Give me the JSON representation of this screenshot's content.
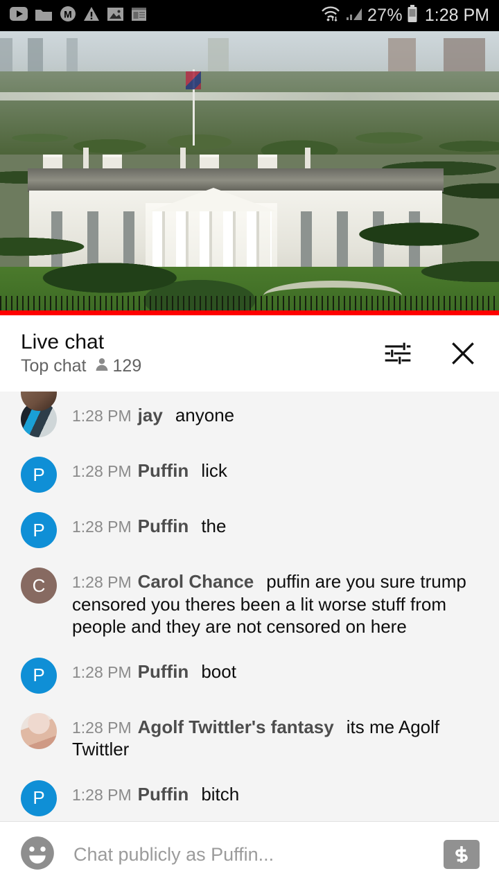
{
  "status_bar": {
    "left_icons": [
      {
        "name": "youtube-icon",
        "label": "YouTube"
      },
      {
        "name": "folder-icon",
        "label": "Folder"
      },
      {
        "name": "m-app-icon",
        "label": "M app"
      },
      {
        "name": "warning-icon",
        "label": "Warning"
      },
      {
        "name": "image-icon",
        "label": "Screenshot"
      },
      {
        "name": "notepad-icon",
        "label": "Notepad"
      }
    ],
    "wifi_icon": "wifi-icon",
    "signal_icon": "cellular-signal-icon",
    "battery_percent": "27%",
    "battery_icon": "battery-icon",
    "clock": "1:28 PM"
  },
  "video": {
    "name": "white-house-live-stream",
    "progress_percent": 100,
    "progress_color": "#ff0000"
  },
  "chat_header": {
    "title": "Live chat",
    "mode": "Top chat",
    "viewer_icon": "person-icon",
    "viewer_count": "129",
    "settings_icon": "tune-icon",
    "close_icon": "close-icon"
  },
  "messages": [
    {
      "avatar_type": "photo",
      "avatar_class": "photo-jay",
      "avatar_initial": "",
      "timestamp": "1:28 PM",
      "author": "jay",
      "text": "anyone"
    },
    {
      "avatar_type": "initial",
      "avatar_class": "initial-p",
      "avatar_initial": "P",
      "timestamp": "1:28 PM",
      "author": "Puffin",
      "text": "lick"
    },
    {
      "avatar_type": "initial",
      "avatar_class": "initial-p",
      "avatar_initial": "P",
      "timestamp": "1:28 PM",
      "author": "Puffin",
      "text": "the"
    },
    {
      "avatar_type": "initial",
      "avatar_class": "initial-c",
      "avatar_initial": "C",
      "timestamp": "1:28 PM",
      "author": "Carol Chance",
      "text": "puffin are you sure trump censored you theres been a lit worse stuff from people and they are not censored on here"
    },
    {
      "avatar_type": "initial",
      "avatar_class": "initial-p",
      "avatar_initial": "P",
      "timestamp": "1:28 PM",
      "author": "Puffin",
      "text": "boot"
    },
    {
      "avatar_type": "photo",
      "avatar_class": "photo-agolf",
      "avatar_initial": "",
      "timestamp": "1:28 PM",
      "author": "Agolf Twittler's fantasy",
      "text": "its me Agolf Twittler"
    },
    {
      "avatar_type": "initial",
      "avatar_class": "initial-p",
      "avatar_initial": "P",
      "timestamp": "1:28 PM",
      "author": "Puffin",
      "text": "bitch"
    }
  ],
  "input_bar": {
    "emoji_icon": "emoji-smiley-icon",
    "placeholder": "Chat publicly as Puffin...",
    "value": "",
    "superchat_icon": "dollar-superchat-icon"
  },
  "colors": {
    "accent_red": "#ff0000",
    "avatar_blue": "#0f8fd6",
    "avatar_brown": "#876a61",
    "chat_bg": "#f4f4f4",
    "status_bar_bg": "#000000"
  }
}
